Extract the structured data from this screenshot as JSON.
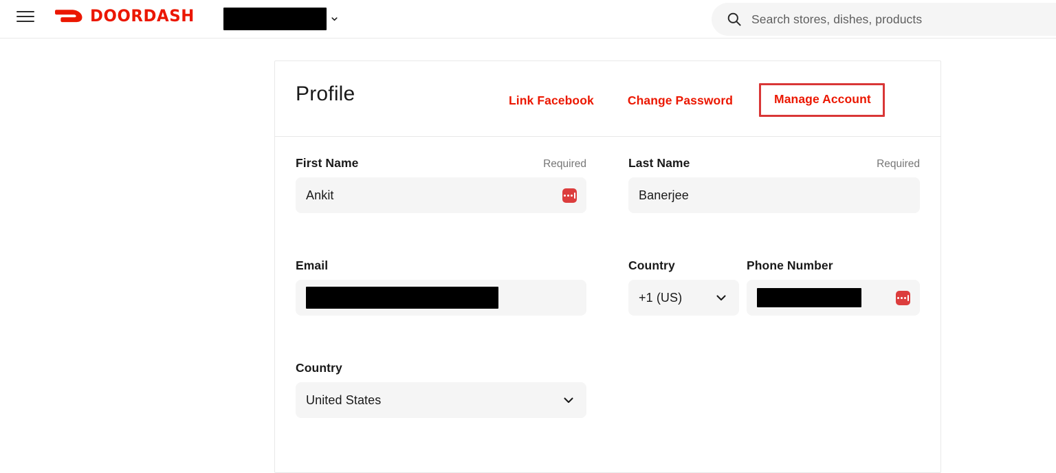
{
  "topbar": {
    "menu_icon": "hamburger-menu-icon",
    "logo_text": "DOORDASH",
    "logo_mark": "doordash-dash-icon",
    "address_value": "",
    "address_redacted": true,
    "address_chevron_icon": "chevron-down-icon",
    "search": {
      "icon": "search-icon",
      "placeholder": "Search stores, dishes, products",
      "value": ""
    }
  },
  "card": {
    "title": "Profile",
    "links": {
      "link_facebook": "Link Facebook",
      "change_password": "Change Password",
      "manage_account": "Manage Account"
    },
    "highlight_color": "#d93636",
    "accent_color": "#eb1700"
  },
  "form": {
    "first_name": {
      "label": "First Name",
      "required_text": "Required",
      "value": "Ankit",
      "autofill_icon": "password-manager-icon"
    },
    "last_name": {
      "label": "Last Name",
      "required_text": "Required",
      "value": "Banerjee"
    },
    "email": {
      "label": "Email",
      "value": "",
      "redacted": true
    },
    "country_code": {
      "label": "Country",
      "value": "+1 (US)",
      "chevron_icon": "chevron-down-icon"
    },
    "phone_number": {
      "label": "Phone Number",
      "value": "",
      "redacted": true,
      "autofill_icon": "password-manager-icon"
    },
    "country": {
      "label": "Country",
      "value": "United States",
      "chevron_icon": "chevron-down-icon"
    }
  }
}
